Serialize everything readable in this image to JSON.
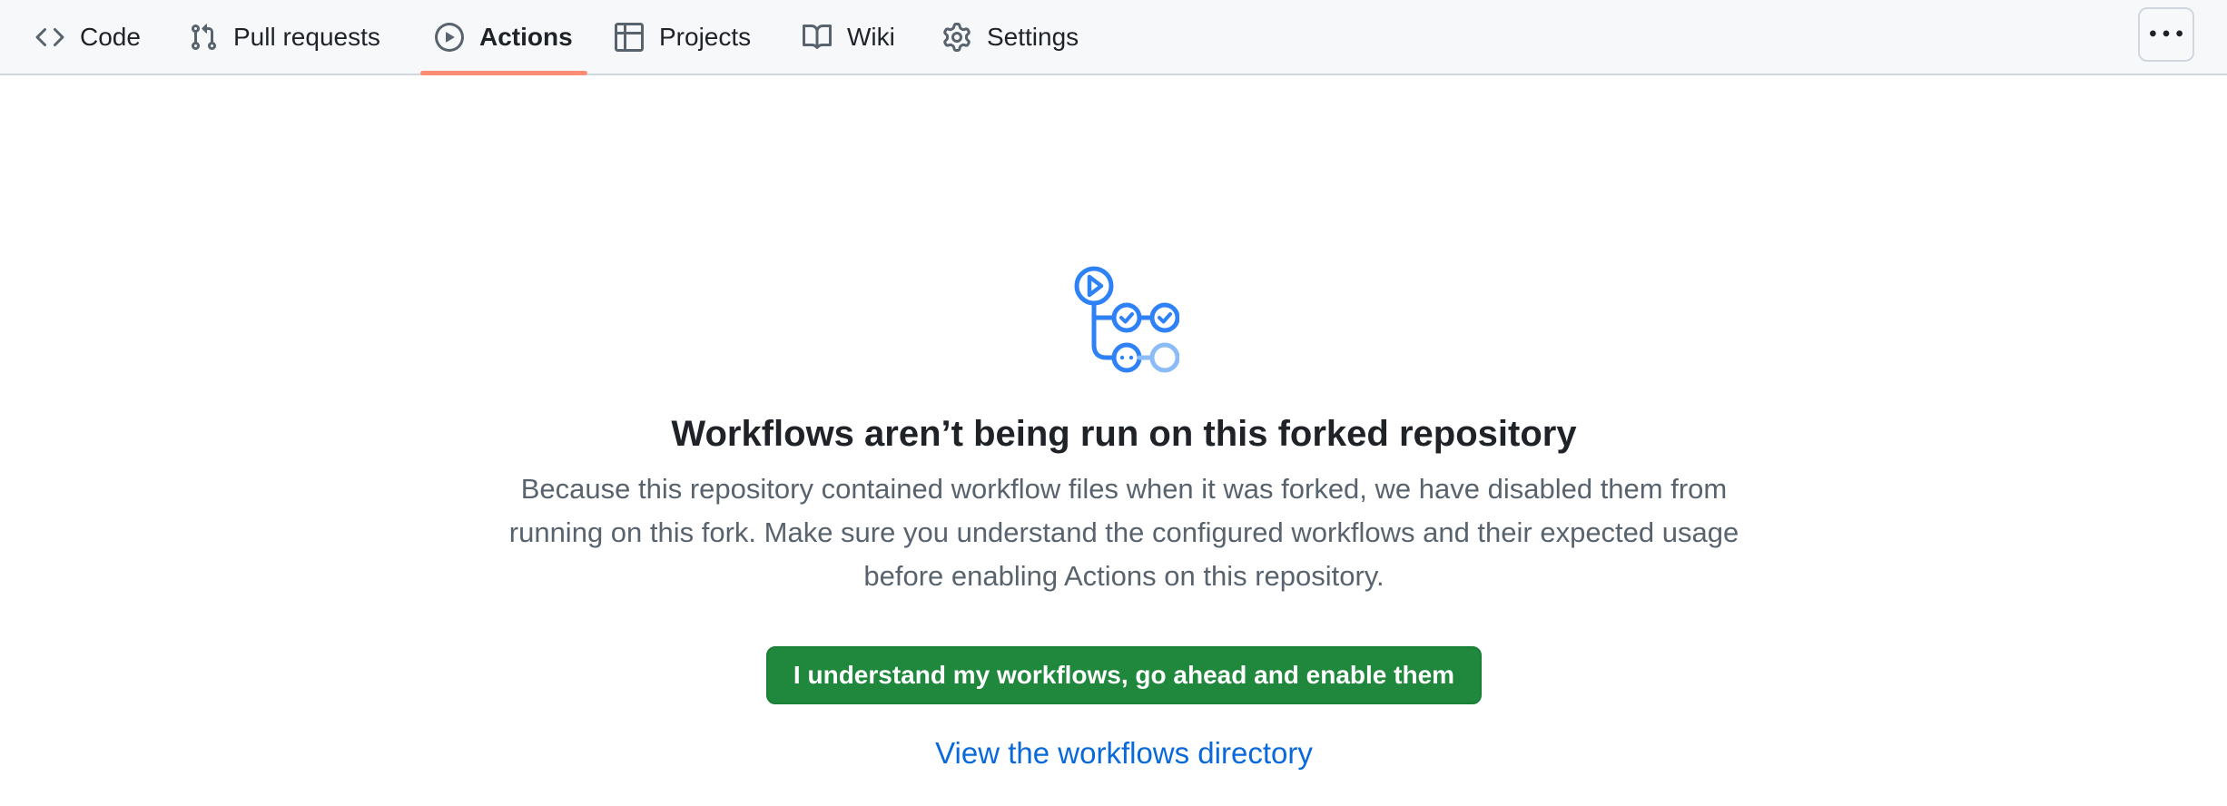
{
  "nav": {
    "tabs": [
      {
        "label": "Code",
        "icon": "code-icon",
        "selected": false
      },
      {
        "label": "Pull requests",
        "icon": "git-pull-request-icon",
        "selected": false
      },
      {
        "label": "Actions",
        "icon": "play-icon",
        "selected": true
      },
      {
        "label": "Projects",
        "icon": "table-icon",
        "selected": false
      },
      {
        "label": "Wiki",
        "icon": "book-icon",
        "selected": false
      },
      {
        "label": "Settings",
        "icon": "gear-icon",
        "selected": false
      }
    ],
    "more_icon": "kebab-horizontal-icon",
    "selected_underline_color": "#fd8c73"
  },
  "blankslate": {
    "icon": "workflow-icon",
    "title": "Workflows aren’t being run on this forked repository",
    "description": "Because this repository contained workflow files when it was forked, we have disabled them from running on this fork. Make sure you understand the configured workflows and their expected usage before enabling Actions on this repository.",
    "enable_button_label": "I understand my workflows, go ahead and enable them",
    "directory_link_label": "View the workflows directory"
  },
  "colors": {
    "primary_button": "#1f883d",
    "link": "#0969da",
    "icon_accent": "#2f81f7"
  }
}
